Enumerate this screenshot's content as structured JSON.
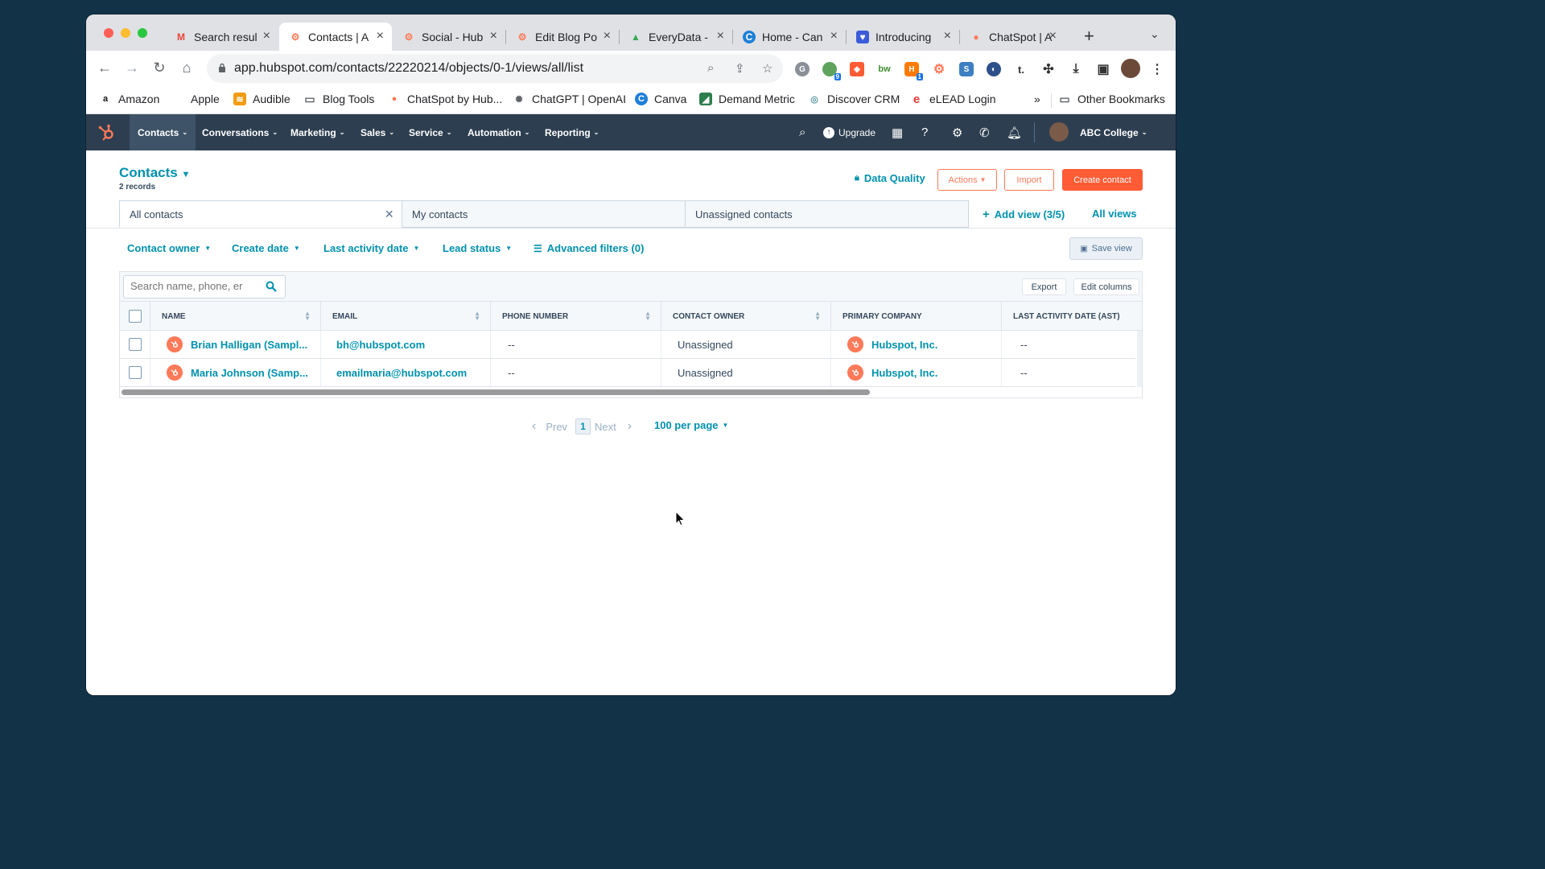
{
  "browser": {
    "tabs": [
      {
        "label": "Search resul",
        "icon": "gmail-icon"
      },
      {
        "label": "Contacts | A",
        "icon": "hubspot-icon",
        "active": true
      },
      {
        "label": "Social - Hub",
        "icon": "hubspot-icon"
      },
      {
        "label": "Edit Blog Po",
        "icon": "hubspot-icon"
      },
      {
        "label": "EveryData -",
        "icon": "drive-icon"
      },
      {
        "label": "Home - Can",
        "icon": "canva-icon"
      },
      {
        "label": "Introducing",
        "icon": "shield-icon"
      },
      {
        "label": "ChatSpot | A",
        "icon": "chatspot-icon"
      }
    ],
    "url": "app.hubspot.com/contacts/22220214/objects/0-1/views/all/list",
    "bookmarks": [
      {
        "label": "Amazon"
      },
      {
        "label": "Apple"
      },
      {
        "label": "Audible"
      },
      {
        "label": "Blog Tools"
      },
      {
        "label": "ChatSpot by Hub..."
      },
      {
        "label": "ChatGPT | OpenAI"
      },
      {
        "label": "Canva"
      },
      {
        "label": "Demand Metric"
      },
      {
        "label": "Discover CRM"
      },
      {
        "label": "eLEAD Login"
      }
    ],
    "bookmarks_overflow": "»",
    "other_bookmarks": "Other Bookmarks",
    "extension_badges": {
      "ext2": "9",
      "ext5": "1"
    }
  },
  "nav": {
    "items": [
      "Contacts",
      "Conversations",
      "Marketing",
      "Sales",
      "Service",
      "Automation",
      "Reporting"
    ],
    "upgrade": "Upgrade",
    "account": "ABC College"
  },
  "page": {
    "title": "Contacts",
    "records": "2 records",
    "data_quality": "Data Quality",
    "actions": "Actions",
    "import": "Import",
    "create": "Create contact"
  },
  "views": {
    "tabs": [
      "All contacts",
      "My contacts",
      "Unassigned contacts"
    ],
    "add_view": "Add view (3/5)",
    "all_views": "All views"
  },
  "filters": {
    "items": [
      "Contact owner",
      "Create date",
      "Last activity date",
      "Lead status"
    ],
    "advanced": "Advanced filters (0)",
    "save_view": "Save view"
  },
  "table": {
    "search_placeholder": "Search name, phone, er",
    "export": "Export",
    "edit_columns": "Edit columns",
    "columns": [
      "NAME",
      "EMAIL",
      "PHONE NUMBER",
      "CONTACT OWNER",
      "PRIMARY COMPANY",
      "LAST ACTIVITY DATE (AST)"
    ],
    "rows": [
      {
        "name": "Brian Halligan (Sampl...",
        "email": "bh@hubspot.com",
        "phone": "--",
        "owner": "Unassigned",
        "company": "Hubspot, Inc.",
        "last_activity": "--"
      },
      {
        "name": "Maria Johnson (Samp...",
        "email": "emailmaria@hubspot.com",
        "phone": "--",
        "owner": "Unassigned",
        "company": "Hubspot, Inc.",
        "last_activity": "--"
      }
    ]
  },
  "pagination": {
    "prev": "Prev",
    "page": "1",
    "next": "Next",
    "per_page": "100 per page"
  },
  "colors": {
    "accent": "#ff5c35",
    "link": "#0091ae",
    "nav": "#2d3e50"
  }
}
